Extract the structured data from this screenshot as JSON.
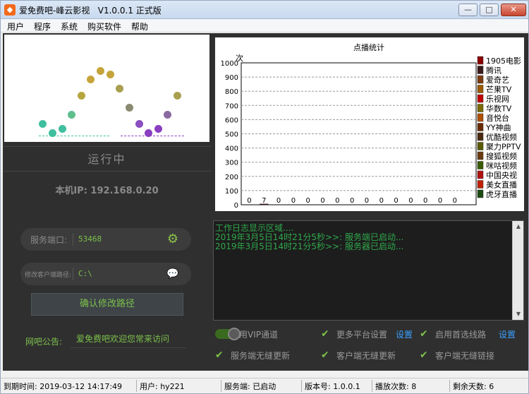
{
  "window": {
    "title": "爱免费吧-峰云影视   V1.0.0.1 正式版",
    "min_label": "—",
    "max_label": "□",
    "close_label": "✕"
  },
  "menu": [
    "用户",
    "程序",
    "系统",
    "购买软件",
    "帮助"
  ],
  "left": {
    "status": "运行中",
    "ip_text": "本机IP: 192.168.0.20",
    "port_label": "服务端口:",
    "port_value": "53468",
    "path_label": "修改客户端路径:",
    "path_value": "C:\\",
    "confirm_label": "确认修改路径",
    "notice_label": "网吧公告:",
    "notice_value": "爱免费吧欢迎您常来访问",
    "gear_icon": "⚙",
    "chat_icon": "💬"
  },
  "chart_data": {
    "type": "bar",
    "title": "点播统计",
    "ylabel": "次",
    "xlabel": "",
    "ylim": [
      0,
      1000
    ],
    "yticks": [
      0,
      100,
      200,
      300,
      400,
      500,
      600,
      700,
      800,
      900,
      1000
    ],
    "grid": true,
    "legend_placement": "right",
    "categories": [
      "1905电影",
      "腾讯",
      "爱奇艺",
      "芒果TV",
      "乐视网",
      "华数TV",
      "音悦台",
      "YY神曲",
      "优酷视频",
      "聚力PPTV",
      "搜狐视频",
      "咪咕视频",
      "中国央视",
      "美女直播",
      "虎牙直播"
    ],
    "values": [
      0,
      7,
      0,
      0,
      0,
      0,
      0,
      0,
      0,
      0,
      0,
      0,
      0,
      0,
      0
    ],
    "colors": [
      "#8b0000",
      "#3a1a1a",
      "#7a3b10",
      "#9a5a00",
      "#c00000",
      "#7a6a00",
      "#b05000",
      "#6a2a00",
      "#4a2a10",
      "#5a5a00",
      "#6a3a10",
      "#3a5a00",
      "#b01010",
      "#c02000",
      "#1a4a10"
    ]
  },
  "log": {
    "lines": [
      "工作日志显示区域....",
      "2019年3月5日14时21分5秒>>: 服务端已启动...",
      "2019年3月5日14时21分5秒>>: 服务器已启动..."
    ]
  },
  "options": {
    "vip_label": "用VIP通道",
    "more_platform": "更多平台设置",
    "settings_label": "设置",
    "preferred_route": "启用首选线路",
    "server_update": "服务端无缝更新",
    "client_update": "客户端无缝更新",
    "client_link": "客户端无缝链接",
    "check_icon": "✔"
  },
  "statusbar": {
    "expiry": "到期时间: 2019-03-12 14:17:49",
    "user": "用户: hy221",
    "server": "服务端: 已启动",
    "version": "版本号: 1.0.0.1",
    "play_count": "播放次数: 8",
    "days_left": "剩余天数: 6"
  }
}
